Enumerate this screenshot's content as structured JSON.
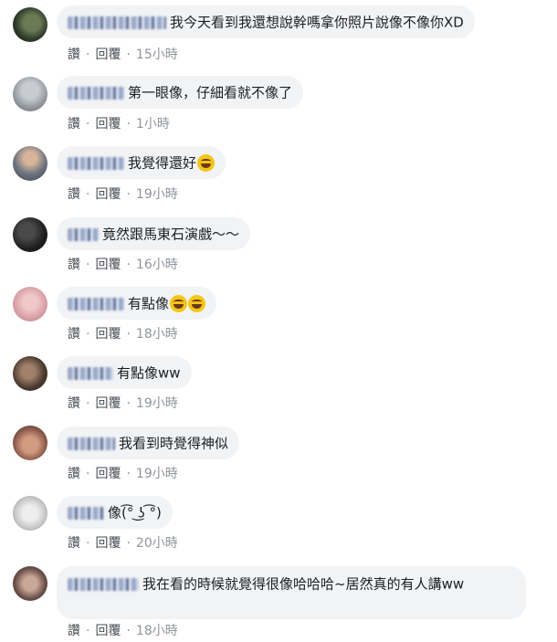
{
  "comments": [
    {
      "text": "我今天看到我還想說幹嗎拿你照片說像不像你XD",
      "like": "讚",
      "reply": "回覆",
      "time": "15小時",
      "emoji": false,
      "avatar_color": "#2f3a2a"
    },
    {
      "text": "第一眼像，仔細看就不像了",
      "like": "讚",
      "reply": "回覆",
      "time": "1小時",
      "emoji": false,
      "avatar_color": "#9aa0a6"
    },
    {
      "text": "我覺得還好",
      "like": "讚",
      "reply": "回覆",
      "time": "19小時",
      "emoji": true,
      "avatar_color": "#7a7f8a"
    },
    {
      "text": "竟然跟馬東石演戲～～",
      "like": "讚",
      "reply": "回覆",
      "time": "16小時",
      "emoji": false,
      "avatar_color": "#1f1f1f"
    },
    {
      "text": "有點像",
      "like": "讚",
      "reply": "回覆",
      "time": "18小時",
      "emoji": true,
      "avatar_color": "#d9a0a8"
    },
    {
      "text": "有點像ww",
      "like": "讚",
      "reply": "回覆",
      "time": "19小時",
      "emoji": false,
      "avatar_color": "#4a3a30"
    },
    {
      "text": "我看到時覺得神似",
      "like": "讚",
      "reply": "回覆",
      "time": "19小時",
      "emoji": false,
      "avatar_color": "#8a5a4a"
    },
    {
      "text": "像(͡° ͜ʖ ͡°)",
      "like": "讚",
      "reply": "回覆",
      "time": "20小時",
      "emoji": false,
      "avatar_color": "#c9c9c9"
    },
    {
      "text": "我在看的時候就覺得很像哈哈哈~居然真的有人講ww",
      "like": "讚",
      "reply": "回覆",
      "time": "18小時",
      "emoji": false,
      "avatar_color": "#6a5048"
    }
  ],
  "separator": "·"
}
